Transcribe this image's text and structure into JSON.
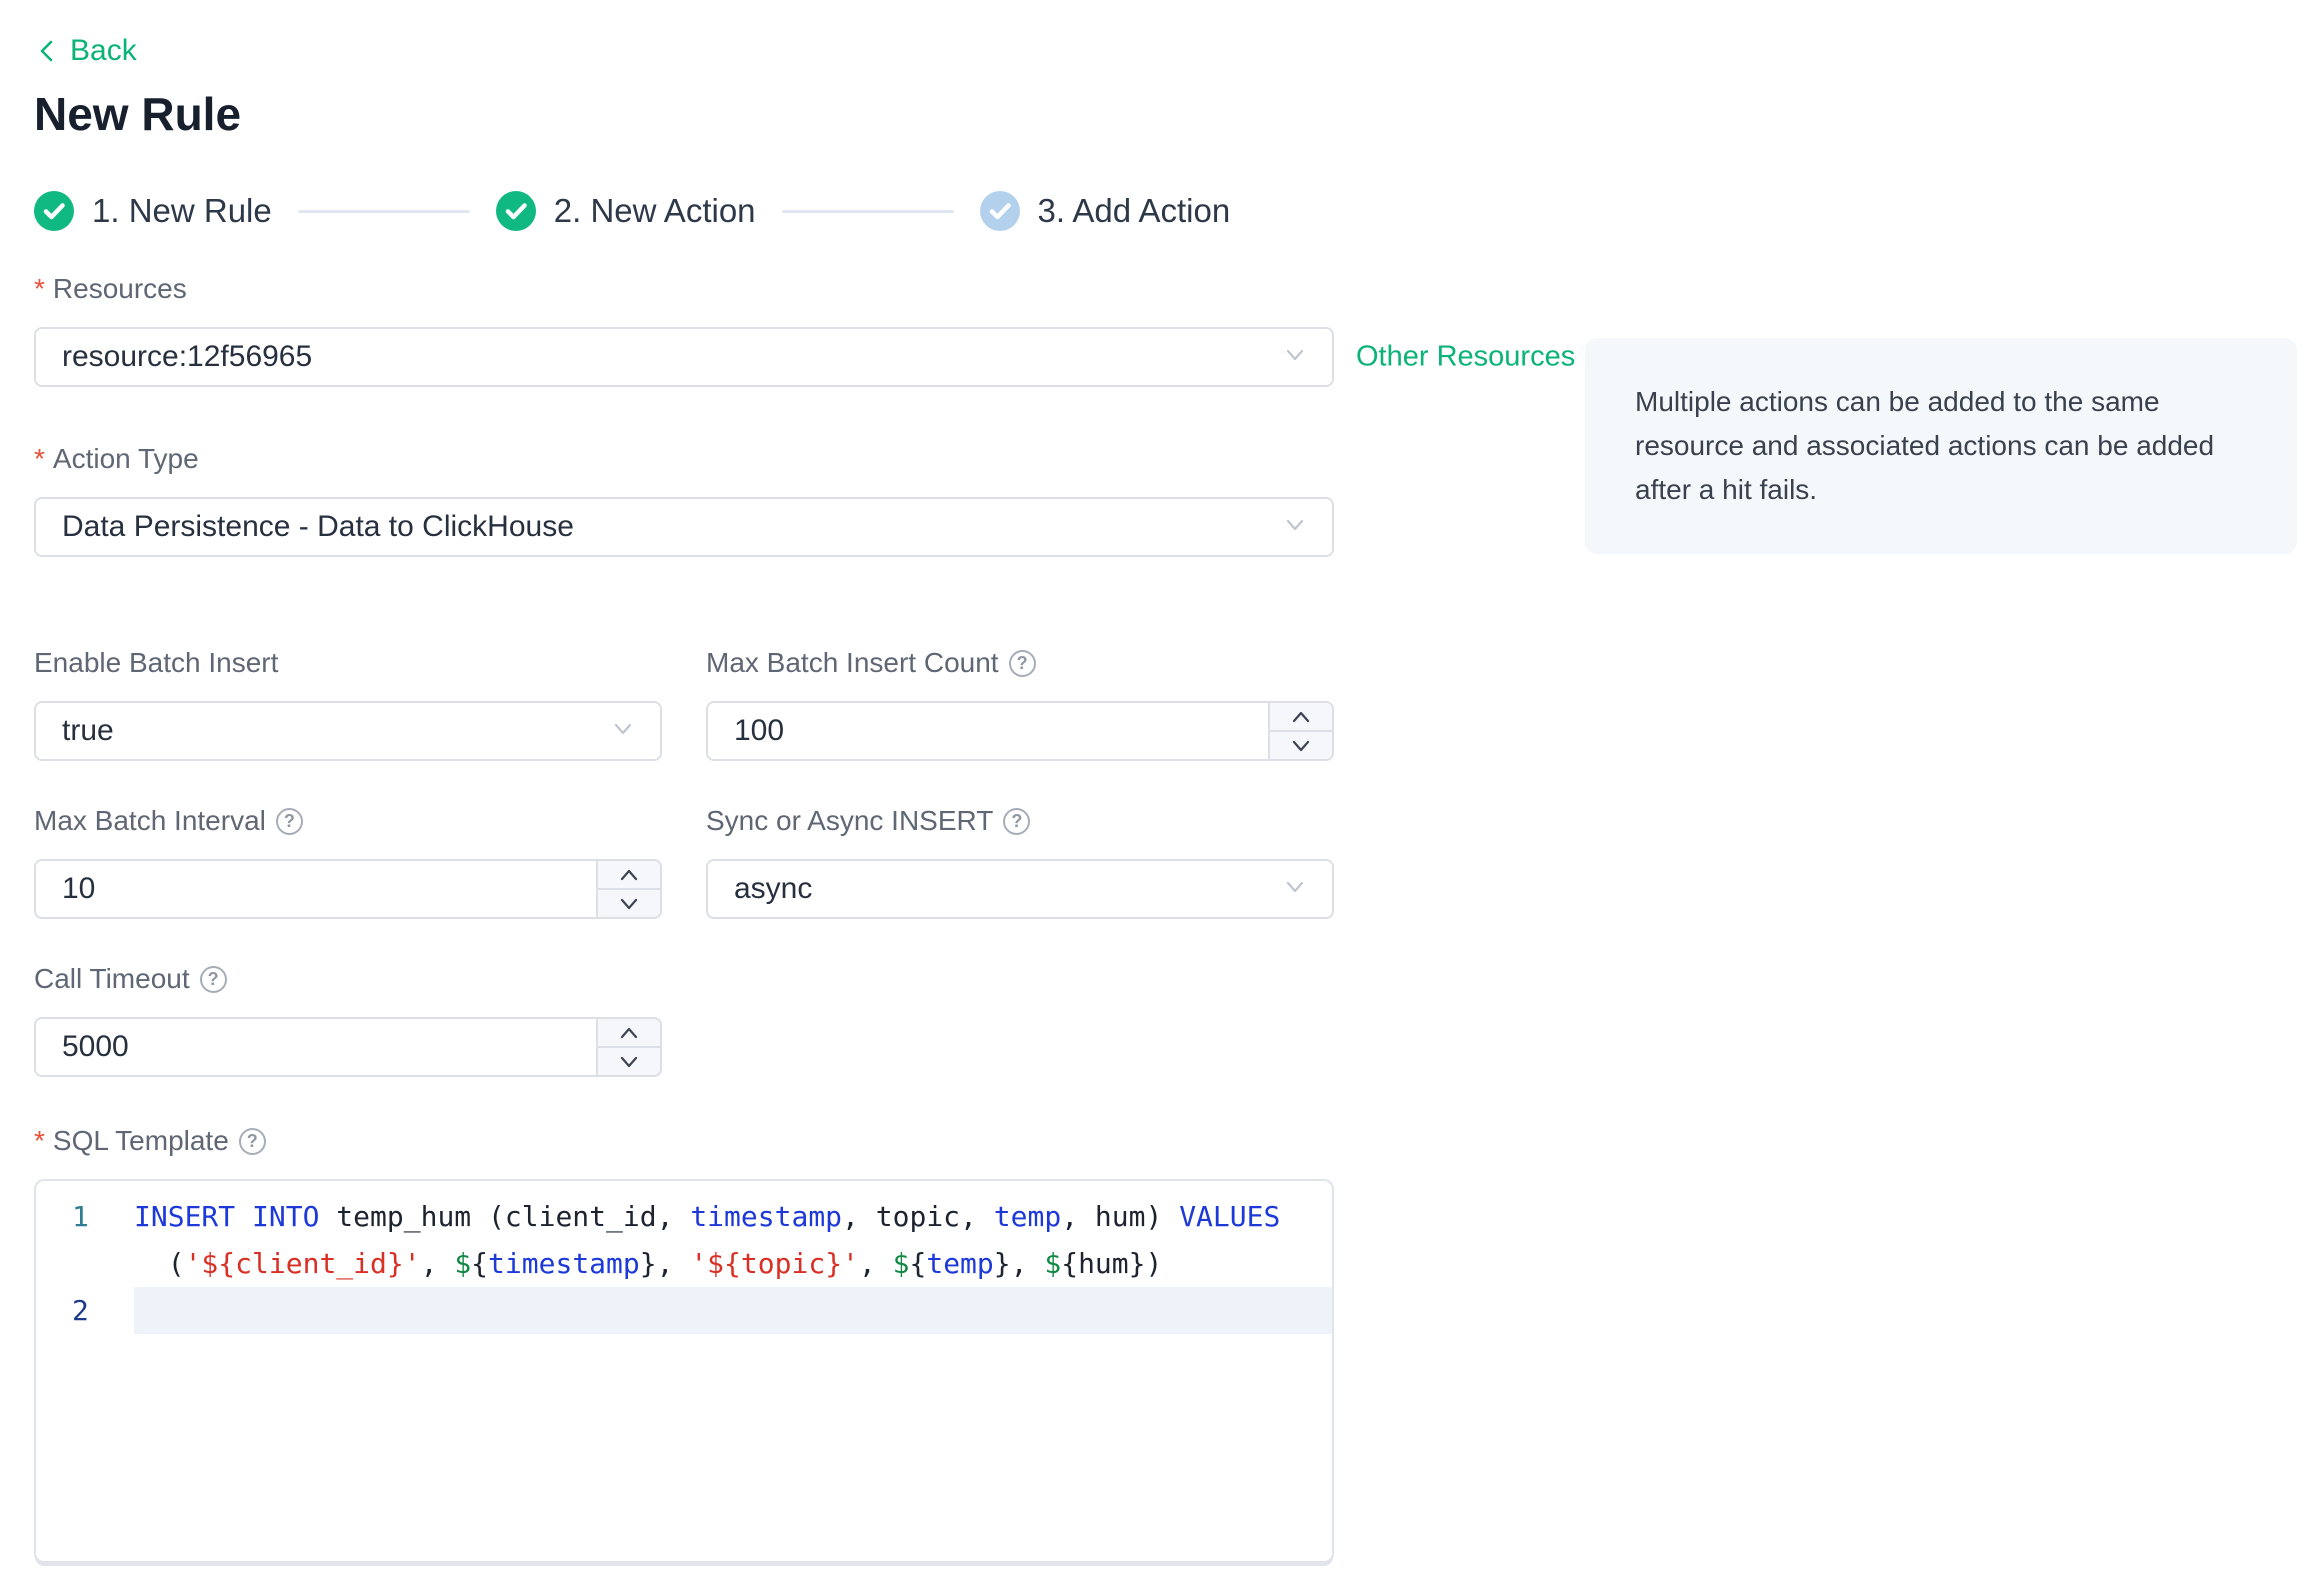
{
  "page": {
    "back_label": "Back",
    "title": "New Rule"
  },
  "steps": [
    {
      "label": "1. New Rule",
      "state": "done"
    },
    {
      "label": "2. New Action",
      "state": "done"
    },
    {
      "label": "3. Add Action",
      "state": "pending"
    }
  ],
  "form": {
    "resources": {
      "label": "Resources",
      "required_marker": "*",
      "value": "resource:12f56965",
      "side_link": "Other Resources"
    },
    "action_type": {
      "label": "Action Type",
      "required_marker": "*",
      "value": "Data Persistence - Data to ClickHouse"
    },
    "enable_batch": {
      "label": "Enable Batch Insert",
      "value": "true"
    },
    "max_batch_count": {
      "label": "Max Batch Insert Count",
      "value": "100"
    },
    "max_batch_interval": {
      "label": "Max Batch Interval",
      "value": "10"
    },
    "sync_async": {
      "label": "Sync or Async INSERT",
      "value": "async"
    },
    "call_timeout": {
      "label": "Call Timeout",
      "value": "5000"
    },
    "sql_template": {
      "label": "SQL Template",
      "required_marker": "*"
    }
  },
  "info_box": {
    "text": "Multiple actions can be added to the same resource and associated actions can be added after a hit fails."
  },
  "sql_editor": {
    "lines": [
      {
        "number": "1",
        "active": false,
        "segments": [
          [
            [
              "kw",
              "INSERT INTO"
            ],
            [
              "plain",
              " temp_hum (client_id, "
            ],
            [
              "kw",
              "timestamp"
            ],
            [
              "plain",
              ", topic, "
            ],
            [
              "kw",
              "temp"
            ],
            [
              "plain",
              ", hum) "
            ],
            [
              "kw",
              "VALUES"
            ]
          ],
          [
            [
              "plain",
              "  ("
            ],
            [
              "str",
              "'${client_id}'"
            ],
            [
              "plain",
              ", "
            ],
            [
              "var",
              "$"
            ],
            [
              "plain",
              "{"
            ],
            [
              "kw",
              "timestamp"
            ],
            [
              "plain",
              "}, "
            ],
            [
              "str",
              "'${topic}'"
            ],
            [
              "plain",
              ", "
            ],
            [
              "var",
              "$"
            ],
            [
              "plain",
              "{"
            ],
            [
              "kw",
              "temp"
            ],
            [
              "plain",
              "}, "
            ],
            [
              "var",
              "$"
            ],
            [
              "plain",
              "{hum})"
            ]
          ]
        ]
      },
      {
        "number": "2",
        "active": true,
        "segments": [
          []
        ]
      }
    ]
  },
  "icons": {
    "back": "chevron-left-icon",
    "step_done": "check-circle-icon",
    "step_pending": "check-circle-icon",
    "select": "chevron-down-icon",
    "spin_up": "chevron-up-icon",
    "spin_down": "chevron-down-icon",
    "help_glyph": "?"
  },
  "colors": {
    "brand_green": "#0bb377",
    "step_done_green": "#10b981",
    "step_pending_blue": "#b3d1ed",
    "required_red": "#ee4f38",
    "info_box_bg": "#f5f8fb",
    "input_border": "#dcdfe6",
    "active_line_bg": "#eef3f9",
    "code_keyword": "#1d39d8",
    "code_string": "#d93026",
    "code_variable": "#118844",
    "gutter_number": "#2f7f93",
    "gutter_number_active": "#1e3a8a"
  }
}
